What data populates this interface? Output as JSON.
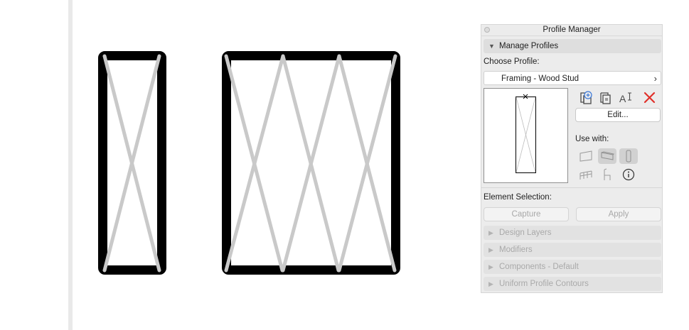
{
  "panel": {
    "title": "Profile Manager",
    "manage_profiles": "Manage Profiles",
    "choose_profile_label": "Choose Profile:",
    "profile_selected": "Framing - Wood Stud",
    "edit_button": "Edit...",
    "use_with_label": "Use with:",
    "element_selection_label": "Element Selection:",
    "capture_button": "Capture",
    "apply_button": "Apply",
    "sections": [
      {
        "label": "Design Layers"
      },
      {
        "label": "Modifiers"
      },
      {
        "label": "Components - Default"
      },
      {
        "label": "Uniform Profile Contours"
      }
    ],
    "icons": {
      "new_profile": "new-profile-icon",
      "duplicate_profile": "duplicate-profile-icon",
      "rename_profile": "rename-profile-icon",
      "delete_profile": "delete-profile-icon",
      "wall": "wall-element-icon",
      "beam": "beam-element-icon",
      "column": "column-element-icon",
      "railing": "railing-element-icon",
      "object": "object-element-icon",
      "info": "info-icon"
    },
    "use_with_active": [
      "beam",
      "column"
    ],
    "colors": {
      "delete": "#e0302a",
      "accent": "#4a4a4a"
    }
  }
}
